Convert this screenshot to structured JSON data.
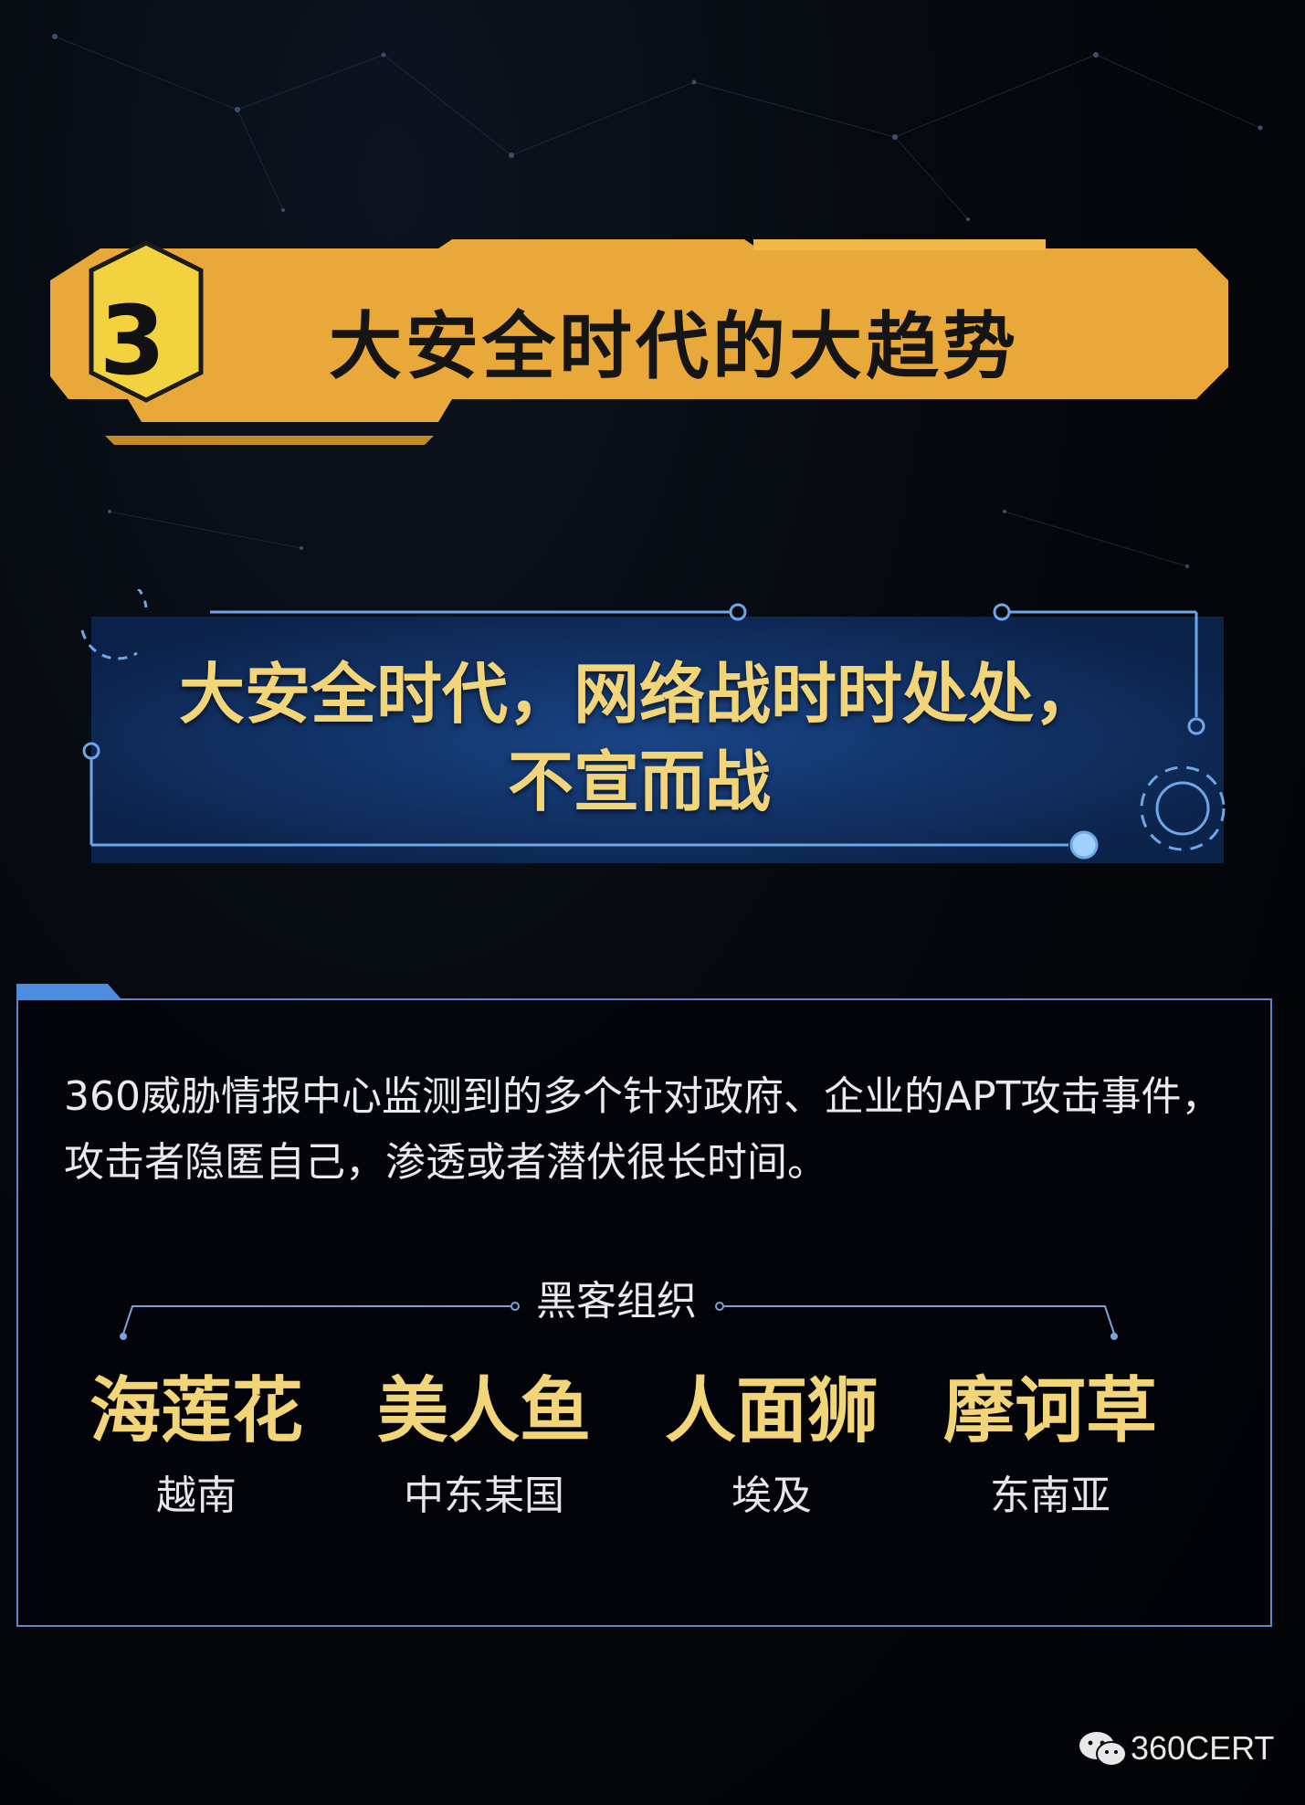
{
  "header": {
    "number": "3",
    "title": "大安全时代的大趋势"
  },
  "slogan": {
    "line1": "大安全时代，网络战时时处处，",
    "line2": "不宣而战"
  },
  "intro": {
    "text": "360威胁情报中心监测到的多个针对政府、企业的APT攻击事件，攻击者隐匿自己，渗透或者潜伏很长时间。"
  },
  "orgs": {
    "heading": "黑客组织",
    "items": [
      {
        "name": "海莲花",
        "region": "越南"
      },
      {
        "name": "美人鱼",
        "region": "中东某国"
      },
      {
        "name": "人面狮",
        "region": "埃及"
      },
      {
        "name": "摩诃草",
        "region": "东南亚"
      }
    ]
  },
  "footer": {
    "icon": "wechat-icon",
    "label": "360CERT"
  },
  "colors": {
    "banner": "#e9a93a",
    "gold_text": "#f2d479",
    "panel_border": "#5f86c5",
    "slogan_bg": "#0f2a5a"
  }
}
